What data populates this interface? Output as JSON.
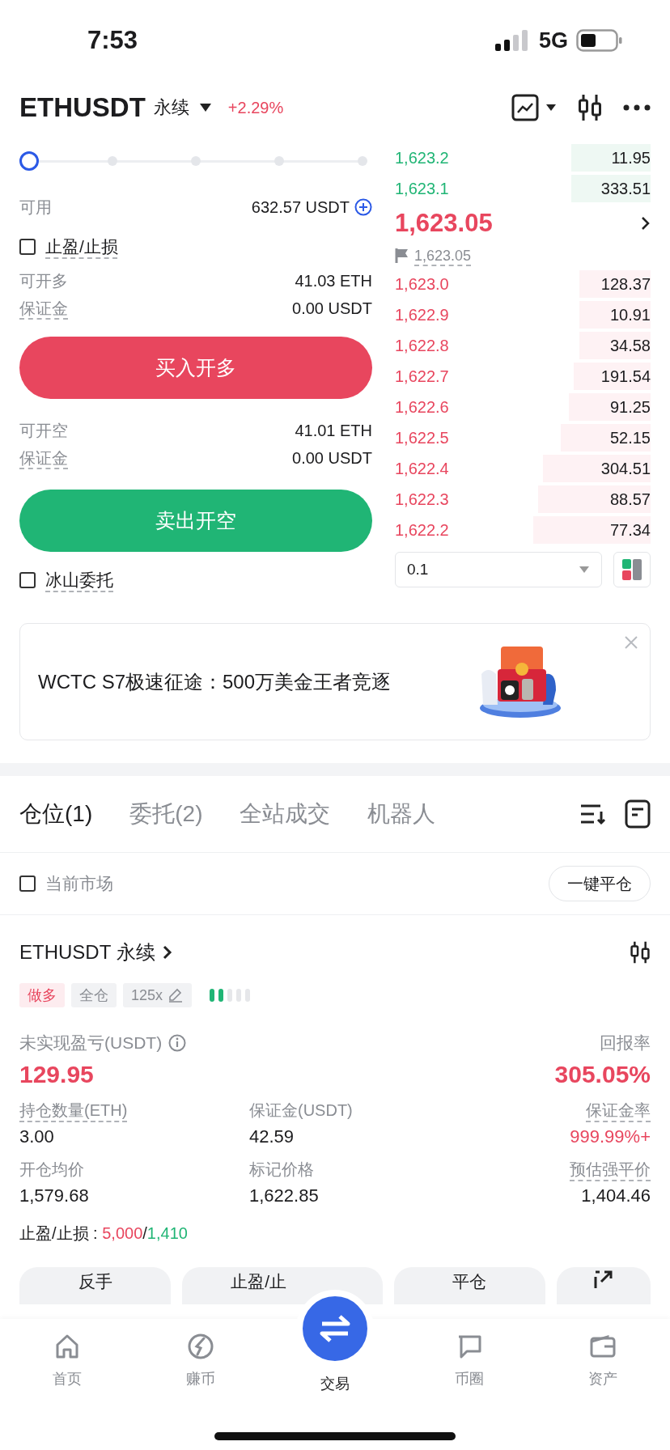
{
  "status_bar": {
    "time": "7:53",
    "network": "5G"
  },
  "header": {
    "symbol": "ETHUSDT",
    "contract": "永续",
    "change": "+2.29%"
  },
  "order_form": {
    "slider": {
      "level": 0
    },
    "available_label": "可用",
    "available_value": "632.57 USDT",
    "tpsl": {
      "label": "止盈/止损",
      "checked": false
    },
    "long": {
      "rows": [
        {
          "label": "可开多",
          "value": "41.03 ETH",
          "underlined": false
        },
        {
          "label": "保证金",
          "value": "0.00 USDT",
          "underlined": true
        }
      ],
      "button": "买入开多"
    },
    "short": {
      "rows": [
        {
          "label": "可开空",
          "value": "41.01 ETH",
          "underlined": false
        },
        {
          "label": "保证金",
          "value": "0.00 USDT",
          "underlined": true
        }
      ],
      "button": "卖出开空"
    },
    "iceberg": {
      "label": "冰山委托",
      "checked": false
    }
  },
  "order_book": {
    "upper": [
      {
        "price": "1,623.2",
        "amount": "11.95"
      },
      {
        "price": "1,623.1",
        "amount": "333.51"
      }
    ],
    "last_price": "1,623.05",
    "mark_price": "1,623.05",
    "lower": [
      {
        "price": "1,623.0",
        "amount": "128.37"
      },
      {
        "price": "1,622.9",
        "amount": "10.91"
      },
      {
        "price": "1,622.8",
        "amount": "34.58"
      },
      {
        "price": "1,622.7",
        "amount": "191.54"
      },
      {
        "price": "1,622.6",
        "amount": "91.25"
      },
      {
        "price": "1,622.5",
        "amount": "52.15"
      },
      {
        "price": "1,622.4",
        "amount": "304.51"
      },
      {
        "price": "1,622.3",
        "amount": "88.57"
      },
      {
        "price": "1,622.2",
        "amount": "77.34"
      }
    ],
    "precision": "0.1"
  },
  "banner": {
    "text": "WCTC S7极速征途：500万美金王者竞逐"
  },
  "positions": {
    "tabs": [
      {
        "label": "仓位(1)",
        "selected": true
      },
      {
        "label": "委托(2)",
        "selected": false
      },
      {
        "label": "全站成交",
        "selected": false
      },
      {
        "label": "机器人",
        "selected": false
      }
    ],
    "filter": {
      "label": "当前市场",
      "checked": false
    },
    "close_all": "一键平仓",
    "card": {
      "symbol": "ETHUSDT",
      "contract": "永续",
      "tags": [
        {
          "label": "做多",
          "kind": "long"
        },
        {
          "label": "全仓",
          "kind": "plain"
        },
        {
          "label": "125x",
          "kind": "editable"
        }
      ],
      "risk": {
        "level": 0.4
      },
      "pnl_label": "未实现盈亏(USDT)",
      "pnl": "129.95",
      "roe_label": "回报率",
      "roe": "305.05%",
      "fields": [
        {
          "label": "持仓数量(ETH)",
          "value": "3.00",
          "underlined": true,
          "color": "#1c1c1e"
        },
        {
          "label": "保证金(USDT)",
          "value": "42.59",
          "underlined": false,
          "color": "#1c1c1e"
        },
        {
          "label": "保证金率",
          "value": "999.99%+",
          "underlined": true,
          "color": "#e8465e"
        },
        {
          "label": "开仓均价",
          "value": "1,579.68",
          "underlined": false,
          "color": "#1c1c1e"
        },
        {
          "label": "标记价格",
          "value": "1,622.85",
          "underlined": false,
          "color": "#1c1c1e"
        },
        {
          "label": "预估强平价",
          "value": "1,404.46",
          "underlined": true,
          "color": "#1c1c1e"
        }
      ],
      "tpsl_label": "止盈/止损 :",
      "tp": "5,000",
      "tpsl_separator": "/",
      "sl": "1,410",
      "actions": [
        {
          "kind": "text",
          "label": "反手"
        },
        {
          "kind": "text",
          "label": "止盈/止"
        },
        {
          "kind": "text",
          "label": "平仓"
        },
        {
          "kind": "share"
        }
      ]
    }
  },
  "nav": [
    {
      "label": "首页",
      "selected": false
    },
    {
      "label": "赚币",
      "selected": false
    },
    {
      "label": "交易",
      "selected": true
    },
    {
      "label": "币圈",
      "selected": false
    },
    {
      "label": "资产",
      "selected": false
    }
  ]
}
